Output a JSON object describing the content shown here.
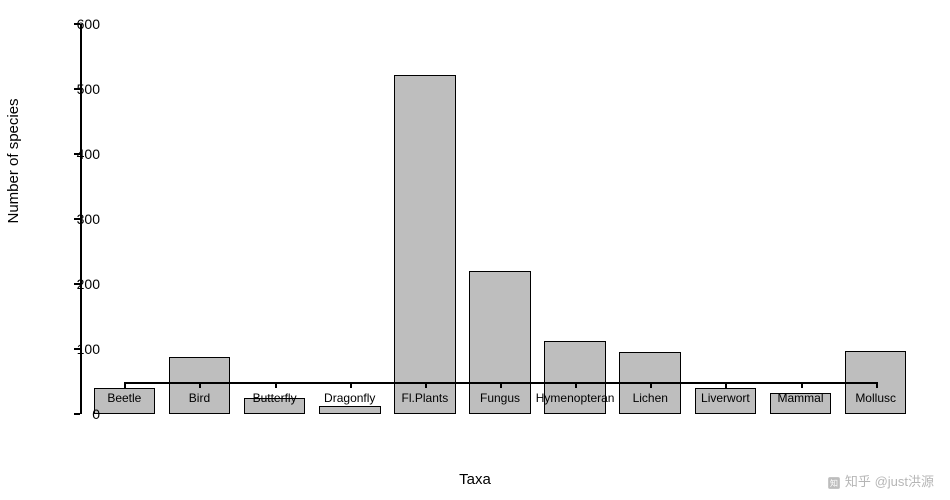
{
  "chart_data": {
    "type": "bar",
    "categories": [
      "Beetle",
      "Bird",
      "Butterfly",
      "Dragonfly",
      "Fl.Plants",
      "Fungus",
      "Hymenopteran",
      "Lichen",
      "Liverwort",
      "Mammal",
      "Mollusc"
    ],
    "values": [
      40,
      88,
      25,
      13,
      522,
      220,
      113,
      95,
      40,
      33,
      97
    ],
    "title": "",
    "xlabel": "Taxa",
    "ylabel": "Number of species",
    "ylim": [
      0,
      600
    ],
    "y_ticks": [
      0,
      100,
      200,
      300,
      400,
      500,
      600
    ],
    "bar_color": "#bebebe"
  },
  "watermark": {
    "text": "@just洪源",
    "prefix": "知乎"
  }
}
